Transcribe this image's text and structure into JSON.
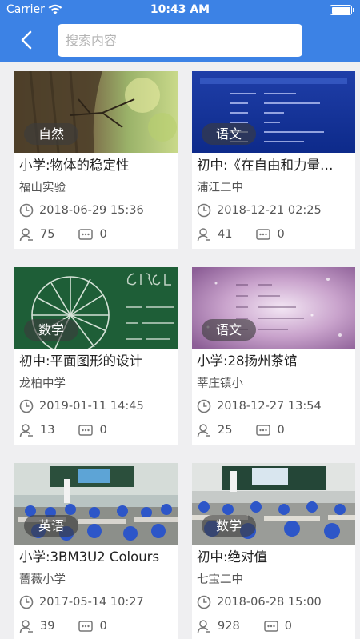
{
  "status_bar": {
    "carrier": "Carrier",
    "time": "10:43 AM"
  },
  "header": {
    "search_placeholder": "搜索内容"
  },
  "colors": {
    "header": "#3c82e5",
    "background": "#efeff1"
  },
  "cards": [
    {
      "tag": "自然",
      "title": "小学:物体的稳定性",
      "school": "福山实验",
      "datetime": "2018-06-29 15:36",
      "likes": "75",
      "comments": "0"
    },
    {
      "tag": "语文",
      "title": "初中:《在自由和力量…",
      "school": "浦江二中",
      "datetime": "2018-12-21 02:25",
      "likes": "41",
      "comments": "0"
    },
    {
      "tag": "数学",
      "title": "初中:平面图形的设计",
      "school": "龙柏中学",
      "datetime": "2019-01-11 14:45",
      "likes": "13",
      "comments": "0"
    },
    {
      "tag": "语文",
      "title": "小学:28扬州茶馆",
      "school": "莘庄镇小",
      "datetime": "2018-12-27 13:54",
      "likes": "25",
      "comments": "0"
    },
    {
      "tag": "英语",
      "title": "小学:3BM3U2 Colours",
      "school": "蔷薇小学",
      "datetime": "2017-05-14 10:27",
      "likes": "39",
      "comments": "0"
    },
    {
      "tag": "数学",
      "title": "初中:绝对值",
      "school": "七宝二中",
      "datetime": "2018-06-28 15:00",
      "likes": "928",
      "comments": "0"
    }
  ]
}
